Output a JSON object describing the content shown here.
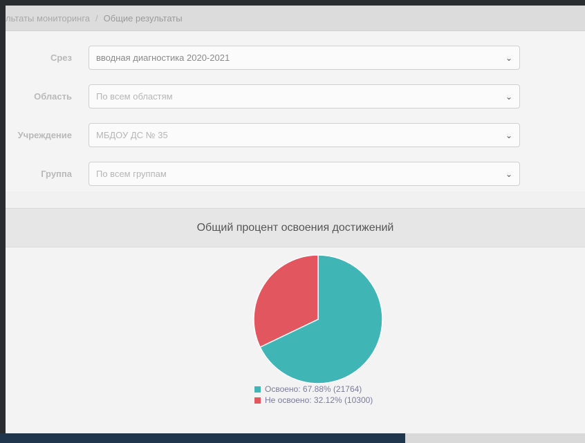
{
  "breadcrumb": {
    "parent": "льтаты мониторинга",
    "separator": "/",
    "current": "Общие результаты"
  },
  "filters": [
    {
      "label": "Срез",
      "value": "вводная диагностика 2020-2021"
    },
    {
      "label": "Область",
      "value": "По всем областям"
    },
    {
      "label": "Учреждение",
      "value": "МБДОУ ДС № 35"
    },
    {
      "label": "Группа",
      "value": "По всем группам"
    }
  ],
  "chart_title": "Общий процент освоения достижений",
  "chart_data": {
    "type": "pie",
    "title": "Общий процент освоения достижений",
    "slices": [
      {
        "label": "Освоено: 67.88% (21764)",
        "value": 21764,
        "percent": 67.88,
        "color": "#3fb5b6"
      },
      {
        "label": "Не освоено: 32.12% (10300)",
        "value": 10300,
        "percent": 32.12,
        "color": "#e2575f"
      }
    ],
    "legend_position": "bottom"
  },
  "colors": {
    "accent_teal": "#3fb5b6",
    "accent_red": "#e2575f"
  }
}
